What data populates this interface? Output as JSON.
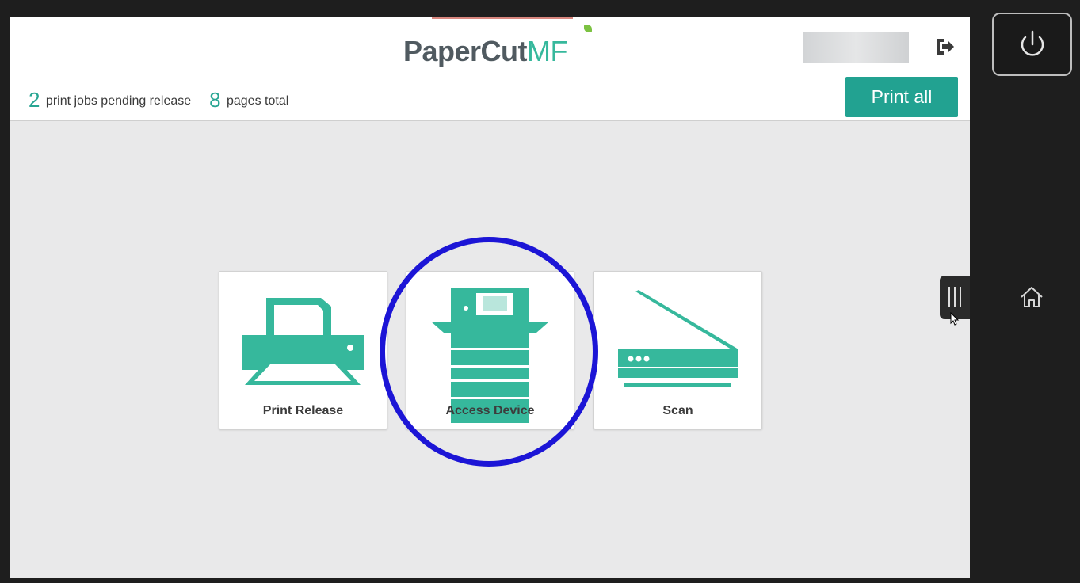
{
  "header": {
    "logo_part1": "PaperCut",
    "logo_part2": "MF"
  },
  "status": {
    "jobs_count": "2",
    "jobs_text": "print jobs pending release",
    "pages_count": "8",
    "pages_text": "pages total"
  },
  "actions": {
    "print_all_label": "Print all"
  },
  "tiles": [
    {
      "label": "Print Release",
      "icon": "printer-icon"
    },
    {
      "label": "Access Device",
      "icon": "copier-icon"
    },
    {
      "label": "Scan",
      "icon": "scanner-icon"
    }
  ],
  "colors": {
    "accent": "#22a291",
    "icon": "#36b89c",
    "highlight": "#1c15d6"
  },
  "device_controls": {
    "power_icon": "power-icon",
    "home_icon": "home-icon",
    "menu_handle_icon": "menu-handle-icon"
  }
}
